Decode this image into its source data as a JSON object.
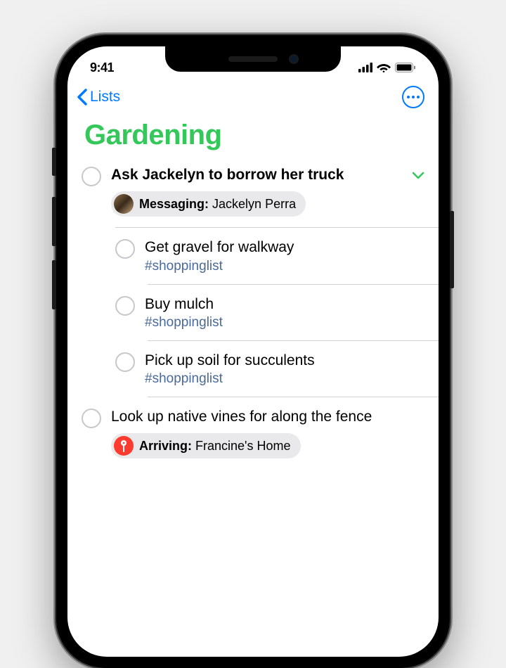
{
  "status": {
    "time": "9:41"
  },
  "nav": {
    "back_label": "Lists"
  },
  "page_title": "Gardening",
  "colors": {
    "accent_green": "#34c759",
    "ios_blue": "#007aff",
    "tag_blue": "#4a6a99",
    "pin_red": "#ff3b30"
  },
  "reminders": [
    {
      "title": "Ask Jackelyn to borrow her truck",
      "level": 0,
      "expanded": true,
      "chip": {
        "type": "contact",
        "label_prefix": "Messaging:",
        "label_value": " Jackelyn Perra"
      },
      "children": [
        {
          "title": "Get gravel for walkway",
          "tag": "#shoppinglist"
        },
        {
          "title": "Buy mulch",
          "tag": "#shoppinglist"
        },
        {
          "title": "Pick up soil for succulents",
          "tag": "#shoppinglist"
        }
      ]
    },
    {
      "title": "Look up native vines for along the fence",
      "level": 0,
      "chip": {
        "type": "location",
        "label_prefix": "Arriving:",
        "label_value": " Francine's Home"
      }
    }
  ]
}
